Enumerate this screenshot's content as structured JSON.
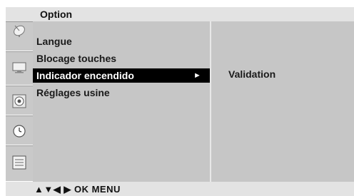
{
  "header": {
    "title": "Option"
  },
  "sidebar": {
    "icons": [
      {
        "name": "satellite-dish-icon"
      },
      {
        "name": "monitor-icon"
      },
      {
        "name": "speaker-icon"
      },
      {
        "name": "clock-icon"
      },
      {
        "name": "option-box-icon"
      }
    ]
  },
  "menu": {
    "items": [
      {
        "label": "Langue"
      },
      {
        "label": "Blocage touches"
      },
      {
        "label": "Indicador encendido",
        "selected": true,
        "arrow": "►"
      },
      {
        "label": "Réglages usine"
      }
    ]
  },
  "submenu": {
    "label": "Validation"
  },
  "footer": {
    "hint": "▲▼◀ ▶ OK MENU"
  }
}
